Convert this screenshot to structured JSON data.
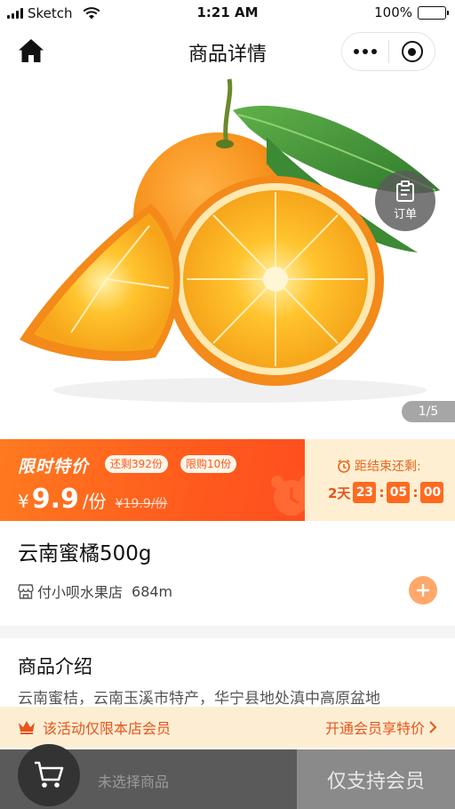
{
  "status_bar": {
    "carrier": "Sketch",
    "time": "1:21 AM",
    "battery": "100%"
  },
  "nav": {
    "title": "商品详情"
  },
  "gallery": {
    "order_label": "订单",
    "pager": "1/5"
  },
  "flash_sale": {
    "title": "限时特价",
    "remaining_tag": "还剩392份",
    "limit_tag": "限购10份",
    "currency": "¥",
    "price": "9.9",
    "unit": "/份",
    "original_price": "¥19.9/份",
    "ends_label": "距结束还剩:",
    "days": "2天",
    "hours": "23",
    "minutes": "05",
    "seconds": "00"
  },
  "product": {
    "name": "云南蜜橘500g",
    "store": "付小呗水果店",
    "distance": "684m"
  },
  "intro": {
    "title": "商品介绍",
    "text": "云南蜜桔，云南玉溪市特产，华宁县地处滇中高原盆地"
  },
  "member_bar": {
    "notice": "该活动仅限本店会员",
    "cta": "开通会员享特价"
  },
  "bottom_bar": {
    "no_item": "未选择商品",
    "action": "仅支持会员"
  },
  "colors": {
    "accent": "#ff5a1d",
    "accent_light": "#ffefd2",
    "bottom_dark": "#5a5a5a",
    "bottom_right": "#8a8a8a"
  }
}
